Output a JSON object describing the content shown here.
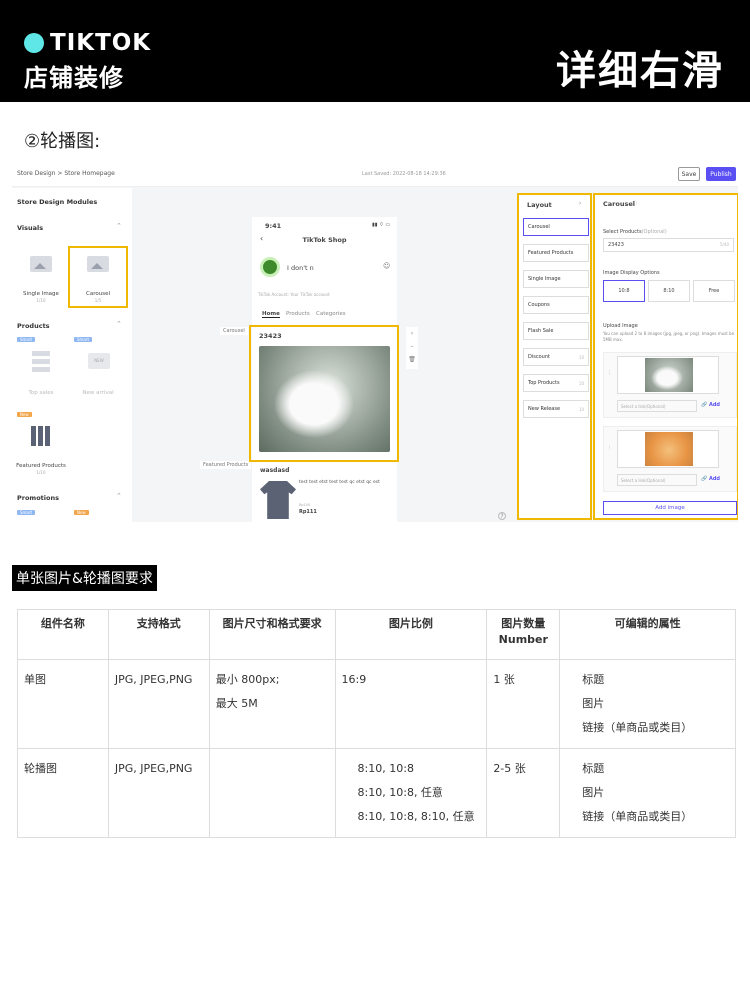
{
  "header": {
    "brand": "TIKTOK",
    "subtitle": "店铺装修",
    "right_title": "详细右滑",
    "accent": "#5ee7e6"
  },
  "section_title": "②轮播图:",
  "screenshot": {
    "breadcrumb": "Store Design > Store Homepage",
    "last_saved": "Last Saved: 2022-08-18 14:29:36",
    "save": "Save",
    "publish": "Publish",
    "left": {
      "title": "Store Design Modules",
      "visuals": "Visuals",
      "single_image": "Single Image",
      "single_image_count": "1/10",
      "carousel": "Carousel",
      "carousel_count": "1/5",
      "products": "Products",
      "top_sales": "Top sales",
      "new_arrival": "New arrival",
      "featured_products": "Featured Products",
      "featured_count": "1/10",
      "promotions": "Promotions",
      "smart": "Smart",
      "new": "New"
    },
    "canvas": {
      "carousel_label": "Carousel",
      "featured_label": "Featured Products"
    },
    "phone": {
      "time": "9:41",
      "title": "TikTok Shop",
      "shop_name": "I don't n",
      "account": "TikTok Account: Your TikTok account",
      "tabs": [
        "Home",
        "Products",
        "Categories"
      ],
      "carousel_title": "23423",
      "product_title": "wasdasd",
      "product_desc": "test test etst test test qc etst qc est",
      "product_label": "Rp100",
      "price": "Rp111"
    },
    "layout": {
      "title": "Layout",
      "items": [
        "Carousel",
        "Featured Products",
        "Single Image",
        "Coupons",
        "Flash Sale",
        "Discount",
        "Top Products",
        "New Release"
      ],
      "counts": [
        "",
        "",
        "",
        "",
        "",
        "10",
        "10",
        "10"
      ]
    },
    "settings": {
      "title": "Carousel",
      "select_label": "Select Products",
      "optional": "(Optional)",
      "select_value": "23423",
      "select_count": "5/40",
      "ratio_label": "Image Display Options",
      "ratios": [
        "10:8",
        "8:10",
        "Free"
      ],
      "upload_label": "Upload Image",
      "upload_hint": "You can upload 2 to 8 images (jpg, jpeg, or png). Images must be 5MB max.",
      "link_placeholder": "Select a link(Optional)",
      "add": "Add",
      "add_image": "Add image"
    }
  },
  "requirements_title": "单张图片&轮播图要求",
  "table": {
    "headers": [
      "组件名称",
      "支持格式",
      "图片尺寸和格式要求",
      "图片比例",
      "图片数量",
      "Number",
      "可编辑的属性"
    ],
    "rows": [
      {
        "name": "单图",
        "format": "JPG, JPEG,PNG",
        "size": [
          "最小 800px;",
          "最大 5M"
        ],
        "ratio": [
          "16:9"
        ],
        "count": "1 张",
        "attrs": [
          "标题",
          "图片",
          "链接（单商品或类目）"
        ]
      },
      {
        "name": "轮播图",
        "format": "JPG, JPEG,PNG",
        "size": [],
        "ratio": [
          "8:10, 10:8",
          "8:10, 10:8, 任意",
          "8:10, 10:8, 8:10, 任意"
        ],
        "count": "2-5 张",
        "attrs": [
          "标题",
          "图片",
          "链接（单商品或类目）"
        ]
      }
    ]
  }
}
